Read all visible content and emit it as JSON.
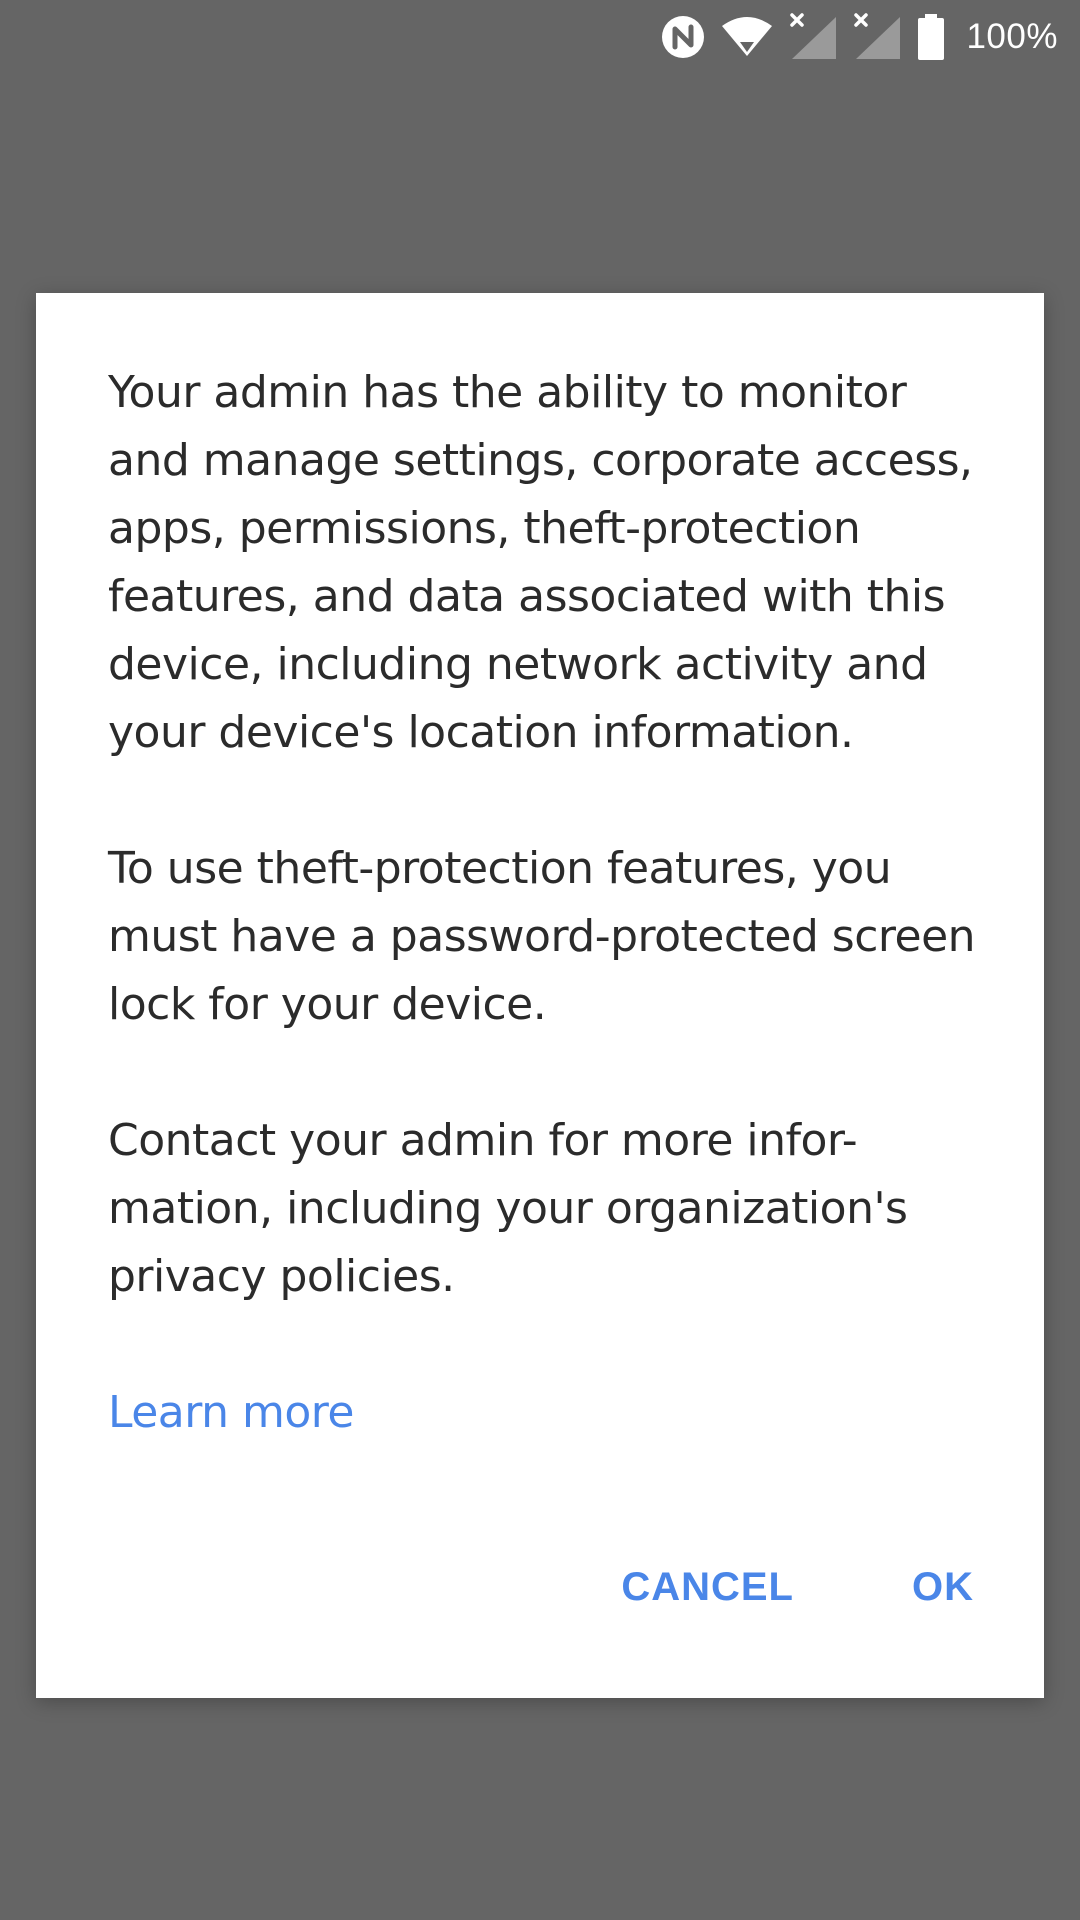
{
  "status_bar": {
    "icons": [
      "nfc-icon",
      "wifi-icon",
      "signal-sim1-icon",
      "signal-sim2-icon",
      "battery-icon"
    ],
    "battery_percent": "100%"
  },
  "dialog": {
    "paragraphs": [
      "Your admin has the ability to monitor and manage settings, corporate access, apps, permissions, theft-protection features, and data associated with this device, including network activity and your device's location information.",
      "To use theft-protection features, you must have a password-protected screen lock for your device.",
      "Contact your admin for more infor-mation, including your organization's privacy policies."
    ],
    "learn_more": "Learn more",
    "cancel_label": "CANCEL",
    "ok_label": "OK"
  },
  "colors": {
    "scrim": "#656565",
    "dialog_background": "#ffffff",
    "body_text": "#2b2b2b",
    "accent": "#4a86e8"
  }
}
